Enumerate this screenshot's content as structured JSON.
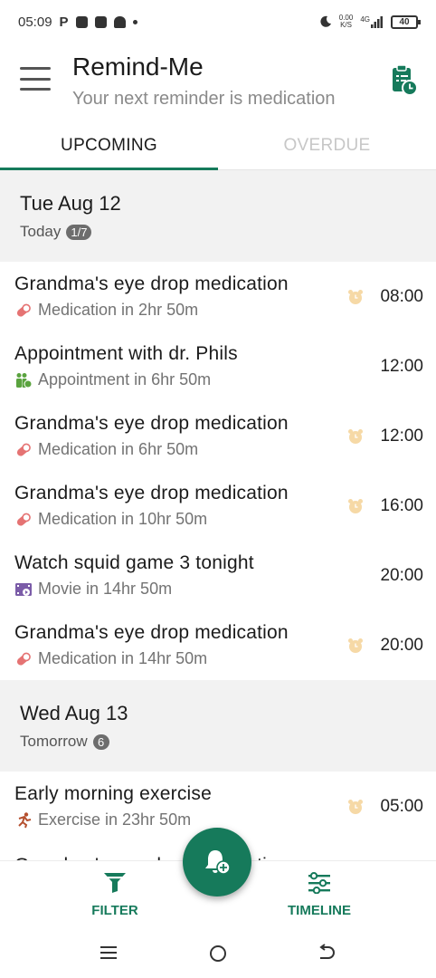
{
  "status_bar": {
    "time": "05:09",
    "carrier_letter": "P",
    "net_speed_top": "0.00",
    "net_speed_bottom": "K/S",
    "network": "4G",
    "battery": "40"
  },
  "app_bar": {
    "title": "Remind-Me",
    "subtitle": "Your next reminder is medication"
  },
  "tabs": [
    {
      "label": "UPCOMING",
      "active": true
    },
    {
      "label": "OVERDUE",
      "active": false
    }
  ],
  "days": [
    {
      "title": "Tue Aug 12",
      "relative": "Today",
      "badge": "1/7",
      "items": [
        {
          "title": "Grandma's eye drop medication",
          "category": "medication",
          "subtitle": "Medication in 2hr 50m",
          "time": "08:00",
          "alarm": true
        },
        {
          "title": "Appointment with dr. Phils",
          "category": "appointment",
          "subtitle": "Appointment in 6hr 50m",
          "time": "12:00",
          "alarm": false
        },
        {
          "title": "Grandma's eye drop medication",
          "category": "medication",
          "subtitle": "Medication in 6hr 50m",
          "time": "12:00",
          "alarm": true
        },
        {
          "title": "Grandma's eye drop medication",
          "category": "medication",
          "subtitle": "Medication in 10hr 50m",
          "time": "16:00",
          "alarm": true
        },
        {
          "title": "Watch squid game 3 tonight",
          "category": "movie",
          "subtitle": "Movie in 14hr 50m",
          "time": "20:00",
          "alarm": false
        },
        {
          "title": "Grandma's eye drop medication",
          "category": "medication",
          "subtitle": "Medication in 14hr 50m",
          "time": "20:00",
          "alarm": true
        }
      ]
    },
    {
      "title": "Wed Aug 13",
      "relative": "Tomorrow",
      "badge": "6",
      "items": [
        {
          "title": "Early morning exercise",
          "category": "exercise",
          "subtitle": "Exercise in 23hr 50m",
          "time": "05:00",
          "alarm": true
        },
        {
          "title": "Grandma's eye drop medication",
          "category": "medication",
          "subtitle": "",
          "time": "",
          "alarm": false
        }
      ]
    }
  ],
  "bottom_bar": {
    "filter_label": "FILTER",
    "timeline_label": "TIMELINE"
  },
  "colors": {
    "accent": "#167a5b",
    "medication": "#e57373",
    "appointment": "#5aa33f",
    "movie": "#7b5ca8",
    "exercise": "#b5502f",
    "alarm": "#f6d9a6"
  },
  "icons": {
    "menu": "menu-icon",
    "clipboard": "clipboard-clock-icon",
    "filter": "filter-icon",
    "timeline": "timeline-icon",
    "fab": "add-reminder-icon",
    "alarm": "alarm-clock-icon"
  }
}
